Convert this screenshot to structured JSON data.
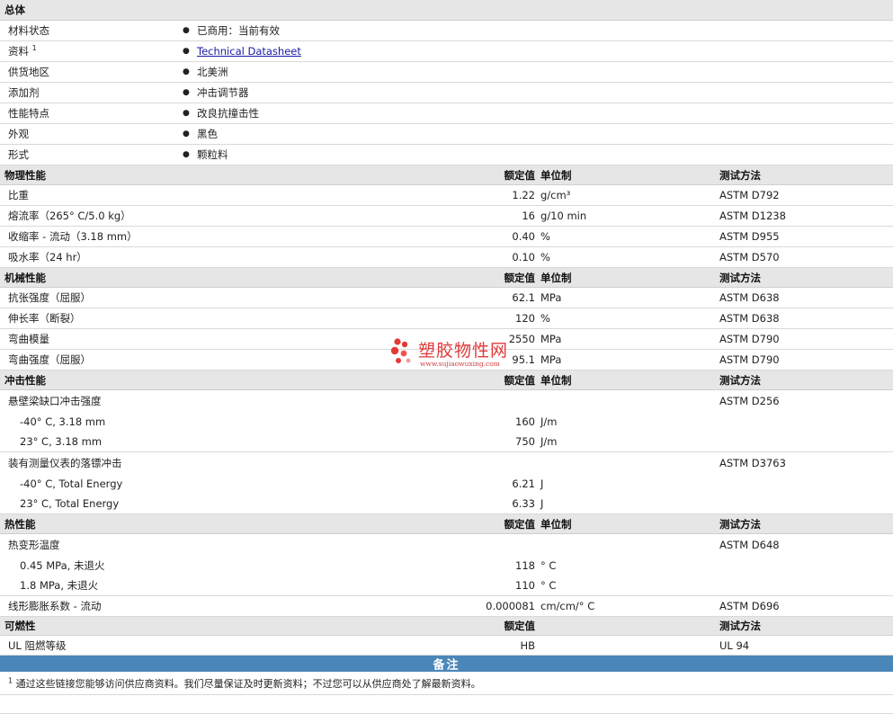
{
  "general": {
    "title": "总体",
    "rows": [
      {
        "label": "材料状态",
        "value": "已商用：当前有效",
        "link": false
      },
      {
        "label": "资料",
        "sup": "1",
        "value": "Technical Datasheet",
        "link": true
      },
      {
        "label": "供货地区",
        "value": "北美洲",
        "link": false
      },
      {
        "label": "添加剂",
        "value": "冲击调节器",
        "link": false
      },
      {
        "label": "性能特点",
        "value": "改良抗撞击性",
        "link": false
      },
      {
        "label": "外观",
        "value": "黑色",
        "link": false
      },
      {
        "label": "形式",
        "value": "颗粒料",
        "link": false
      }
    ],
    "bullet": "●"
  },
  "headers": {
    "nominal": "额定值",
    "unit": "单位制",
    "method": "测试方法"
  },
  "physical": {
    "title": "物理性能",
    "rows": [
      {
        "label": "比重",
        "nominal": "1.22",
        "unit": "g/cm³",
        "method": "ASTM D792"
      },
      {
        "label": "熔流率（265°  C/5.0 kg）",
        "nominal": "16",
        "unit": "g/10 min",
        "method": "ASTM D1238"
      },
      {
        "label": "收缩率 - 流动（3.18 mm）",
        "nominal": "0.40",
        "unit": "%",
        "method": "ASTM D955"
      },
      {
        "label": "吸水率（24 hr）",
        "nominal": "0.10",
        "unit": "%",
        "method": "ASTM D570"
      }
    ]
  },
  "mechanical": {
    "title": "机械性能",
    "rows": [
      {
        "label": "抗张强度（屈服）",
        "nominal": "62.1",
        "unit": "MPa",
        "method": "ASTM D638"
      },
      {
        "label": "伸长率（断裂）",
        "nominal": "120",
        "unit": "%",
        "method": "ASTM D638"
      },
      {
        "label": "弯曲模量",
        "nominal": "2550",
        "unit": "MPa",
        "method": "ASTM D790"
      },
      {
        "label": "弯曲强度（屈服）",
        "nominal": "95.1",
        "unit": "MPa",
        "method": "ASTM D790"
      }
    ]
  },
  "impact": {
    "title": "冲击性能",
    "izod": {
      "label": "悬壁梁缺口冲击强度",
      "method": "ASTM D256"
    },
    "izod_rows": [
      {
        "label": "-40°  C, 3.18 mm",
        "nominal": "160",
        "unit": "J/m"
      },
      {
        "label": "23°  C, 3.18 mm",
        "nominal": "750",
        "unit": "J/m"
      }
    ],
    "dart": {
      "label": "装有测量仪表的落镖冲击",
      "method": "ASTM D3763"
    },
    "dart_rows": [
      {
        "label": "-40°  C, Total Energy",
        "nominal": "6.21",
        "unit": "J"
      },
      {
        "label": "23°  C, Total Energy",
        "nominal": "6.33",
        "unit": "J"
      }
    ]
  },
  "thermal": {
    "title": "热性能",
    "hdt": {
      "label": "热变形温度",
      "method": "ASTM D648"
    },
    "hdt_rows": [
      {
        "label": "0.45 MPa, 未退火",
        "nominal": "118",
        "unit": "°  C"
      },
      {
        "label": "1.8 MPa, 未退火",
        "nominal": "110",
        "unit": "°  C"
      }
    ],
    "clte": {
      "label": "线形膨胀系数 - 流动",
      "nominal": "0.000081",
      "unit": "cm/cm/°  C",
      "method": "ASTM D696"
    }
  },
  "flammability": {
    "title": "可燃性",
    "rows": [
      {
        "label": "UL 阻燃等级",
        "nominal": "HB",
        "method": "UL 94"
      }
    ]
  },
  "notes": {
    "title": "备注",
    "sup": "1",
    "text": "通过这些链接您能够访问供应商资料。我们尽量保证及时更新资料；不过您可以从供应商处了解最新资料。"
  },
  "watermark": {
    "text": "塑胶物性网",
    "url": "www.sujiaowuxing.com"
  }
}
